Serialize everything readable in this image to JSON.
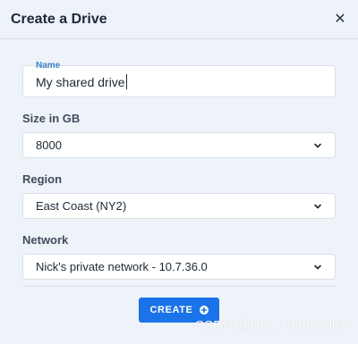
{
  "dialog": {
    "title": "Create a Drive",
    "close_icon": "close-icon"
  },
  "form": {
    "name": {
      "label": "Name",
      "value": "My shared drive"
    },
    "size": {
      "label": "Size in GB",
      "selected": "8000"
    },
    "region": {
      "label": "Region",
      "selected": "East Coast (NY2)"
    },
    "network": {
      "label": "Network",
      "selected": "Nick's private network - 10.7.36.0"
    }
  },
  "actions": {
    "create_label": "CREATE",
    "create_icon": "plus-circle-icon"
  },
  "watermark": "CSDN @DO_Community",
  "colors": {
    "background": "#eef3f9",
    "accent": "#1a73e8",
    "name_label": "#3b82c4"
  }
}
